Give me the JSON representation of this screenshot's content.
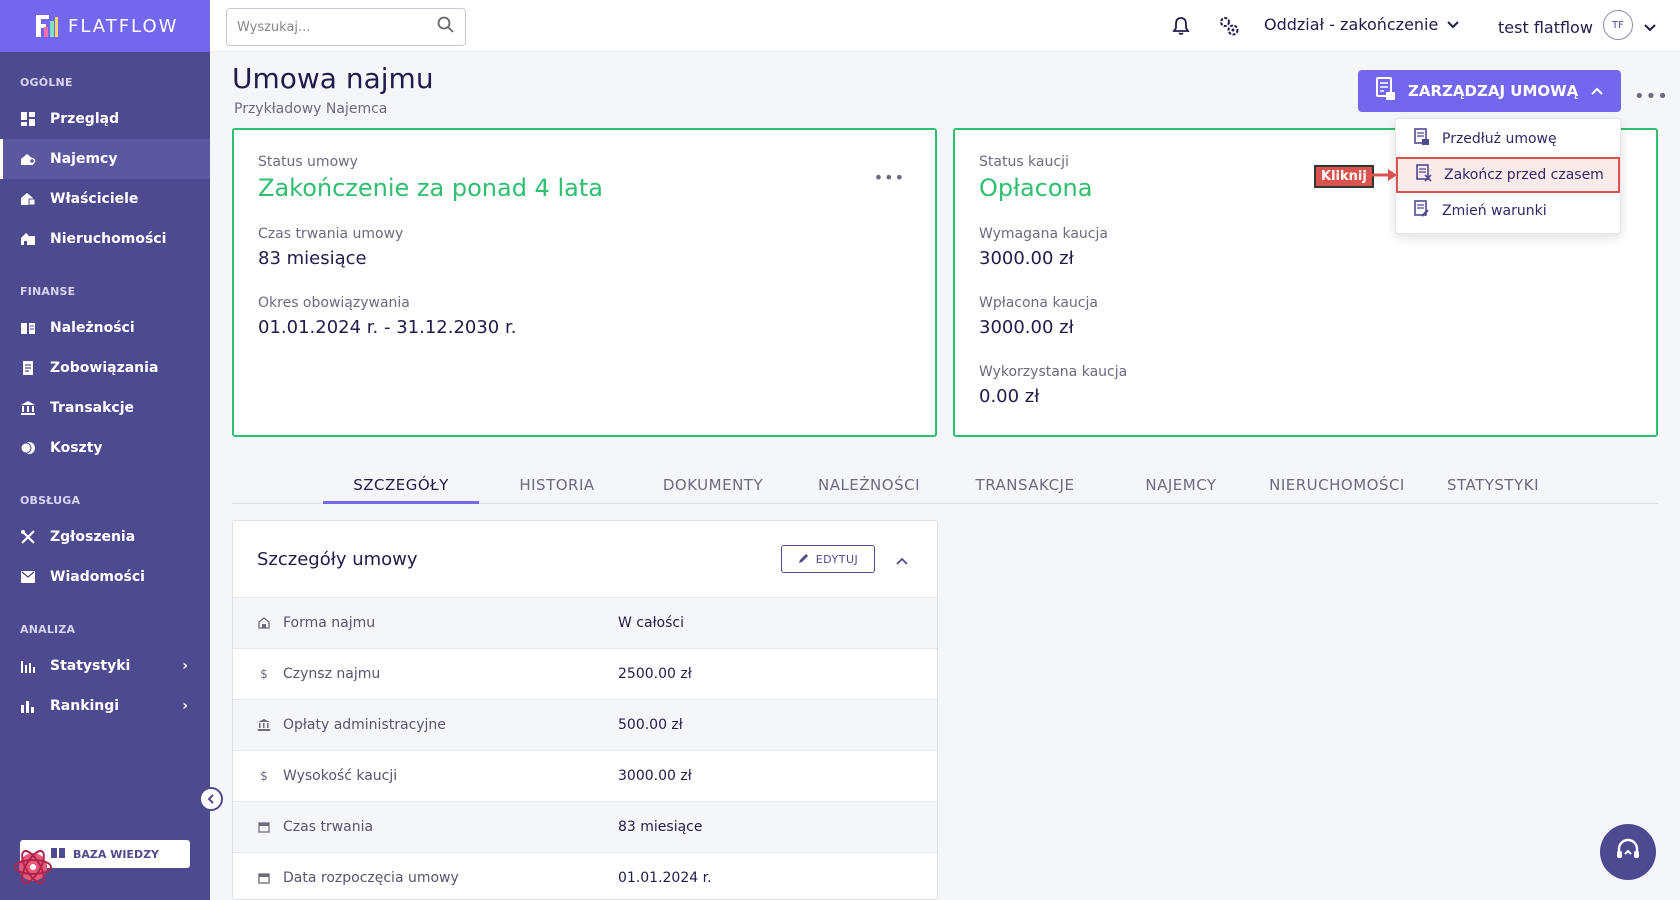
{
  "brand": "FLATFLOW",
  "sidebar": {
    "sections": [
      {
        "title": "OGÓLNE",
        "items": [
          {
            "label": "Przegląd",
            "icon": "dashboard-icon"
          },
          {
            "label": "Najemcy",
            "icon": "tenant-icon",
            "active": true
          },
          {
            "label": "Właściciele",
            "icon": "owners-icon"
          },
          {
            "label": "Nieruchomości",
            "icon": "property-icon"
          }
        ]
      },
      {
        "title": "FINANSE",
        "items": [
          {
            "label": "Należności",
            "icon": "receivables-icon"
          },
          {
            "label": "Zobowiązania",
            "icon": "liabilities-icon"
          },
          {
            "label": "Transakcje",
            "icon": "bank-icon"
          },
          {
            "label": "Koszty",
            "icon": "costs-icon"
          }
        ]
      },
      {
        "title": "OBSŁUGA",
        "items": [
          {
            "label": "Zgłoszenia",
            "icon": "tools-icon"
          },
          {
            "label": "Wiadomości",
            "icon": "mail-icon"
          }
        ]
      },
      {
        "title": "ANALIZA",
        "items": [
          {
            "label": "Statystyki",
            "icon": "stats-icon"
          },
          {
            "label": "Rankingi",
            "icon": "ranking-icon"
          }
        ]
      }
    ],
    "knowledge_base": "BAZA WIEDZY"
  },
  "topbar": {
    "search_placeholder": "Wyszukaj...",
    "branch": "Oddział - zakończenie",
    "user": "test flatflow",
    "avatar": "TF"
  },
  "header": {
    "title": "Umowa najmu",
    "subtitle": "Przykładowy Najemca",
    "manage_button": "ZARZĄDZAJ UMOWĄ"
  },
  "dropdown": {
    "items": [
      {
        "label": "Przedłuż umowę"
      },
      {
        "label": "Zakończ przed czasem"
      },
      {
        "label": "Zmień warunki"
      }
    ],
    "annotation": "Kliknij"
  },
  "contract_card": {
    "status_label": "Status umowy",
    "status_value": "Zakończenie za ponad 4 lata",
    "duration_label": "Czas trwania umowy",
    "duration_value": "83 miesiące",
    "period_label": "Okres obowiązywania",
    "period_value": "01.01.2024 r. - 31.12.2030 r."
  },
  "deposit_card": {
    "status_label": "Status kaucji",
    "status_value": "Opłacona",
    "required_label": "Wymagana kaucja",
    "required_value": "3000.00 zł",
    "paid_label": "Wpłacona kaucja",
    "paid_value": "3000.00 zł",
    "used_label": "Wykorzystana kaucja",
    "used_value": "0.00 zł"
  },
  "tabs": [
    "SZCZEGÓŁY",
    "HISTORIA",
    "DOKUMENTY",
    "NALEŻNOŚCI",
    "TRANSAKCJE",
    "NAJEMCY",
    "NIERUCHOMOŚCI",
    "STATYSTYKI"
  ],
  "details": {
    "title": "Szczegóły umowy",
    "edit_label": "EDYTUJ",
    "rows": [
      {
        "label": "Forma najmu",
        "value": "W całości",
        "icon": "building-icon"
      },
      {
        "label": "Czynsz najmu",
        "value": "2500.00 zł",
        "icon": "dollar-icon"
      },
      {
        "label": "Opłaty administracyjne",
        "value": "500.00 zł",
        "icon": "bank-icon"
      },
      {
        "label": "Wysokość kaucji",
        "value": "3000.00 zł",
        "icon": "dollar-icon"
      },
      {
        "label": "Czas trwania",
        "value": "83 miesiące",
        "icon": "calendar-icon"
      },
      {
        "label": "Data rozpoczęcia umowy",
        "value": "01.01.2024 r.",
        "icon": "calendar-icon"
      }
    ]
  },
  "colors": {
    "primary": "#7367f0",
    "sidebar": "#4e4a8f",
    "success": "#2fbf71",
    "danger": "#d9534f"
  }
}
